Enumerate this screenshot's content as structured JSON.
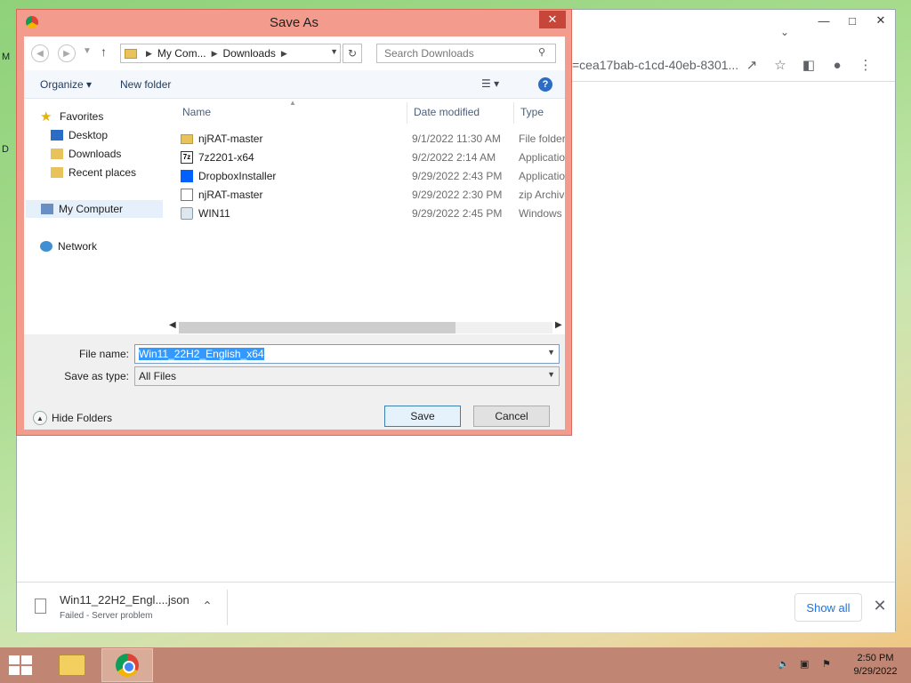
{
  "desktop": {
    "icon_letters": [
      "M",
      "D"
    ]
  },
  "chrome": {
    "url_fragment": "=cea17bab-c1cd-40eb-8301...",
    "download": {
      "filename": "Win11_22H2_Engl....json",
      "status": "Failed - Server problem",
      "show_all": "Show all"
    }
  },
  "dialog": {
    "title": "Save As",
    "breadcrumb": [
      "My Com...",
      "Downloads"
    ],
    "search_placeholder": "Search Downloads",
    "organize": "Organize ▾",
    "new_folder": "New folder",
    "nav": {
      "favorites": "Favorites",
      "desktop": "Desktop",
      "downloads": "Downloads",
      "recent": "Recent places",
      "computer": "My Computer",
      "network": "Network"
    },
    "columns": {
      "name": "Name",
      "date": "Date modified",
      "type": "Type"
    },
    "files": [
      {
        "name": "njRAT-master",
        "date": "9/1/2022 11:30 AM",
        "type": "File folder",
        "icon": "folder-icon"
      },
      {
        "name": "7z2201-x64",
        "date": "9/2/2022 2:14 AM",
        "type": "Application",
        "icon": "7zip-icon"
      },
      {
        "name": "DropboxInstaller",
        "date": "9/29/2022 2:43 PM",
        "type": "Application",
        "icon": "dropbox-icon"
      },
      {
        "name": "njRAT-master",
        "date": "9/29/2022 2:30 PM",
        "type": "zip Archive",
        "icon": "zip-icon"
      },
      {
        "name": "WIN11",
        "date": "9/29/2022 2:45 PM",
        "type": "Windows",
        "icon": "disc-image-icon"
      }
    ],
    "file_name_label": "File name:",
    "file_name_value": "Win11_22H2_English_x64",
    "save_type_label": "Save as type:",
    "save_type_value": "All Files",
    "hide_folders": "Hide Folders",
    "save": "Save",
    "cancel": "Cancel"
  },
  "taskbar": {
    "time": "2:50 PM",
    "date": "9/29/2022"
  }
}
